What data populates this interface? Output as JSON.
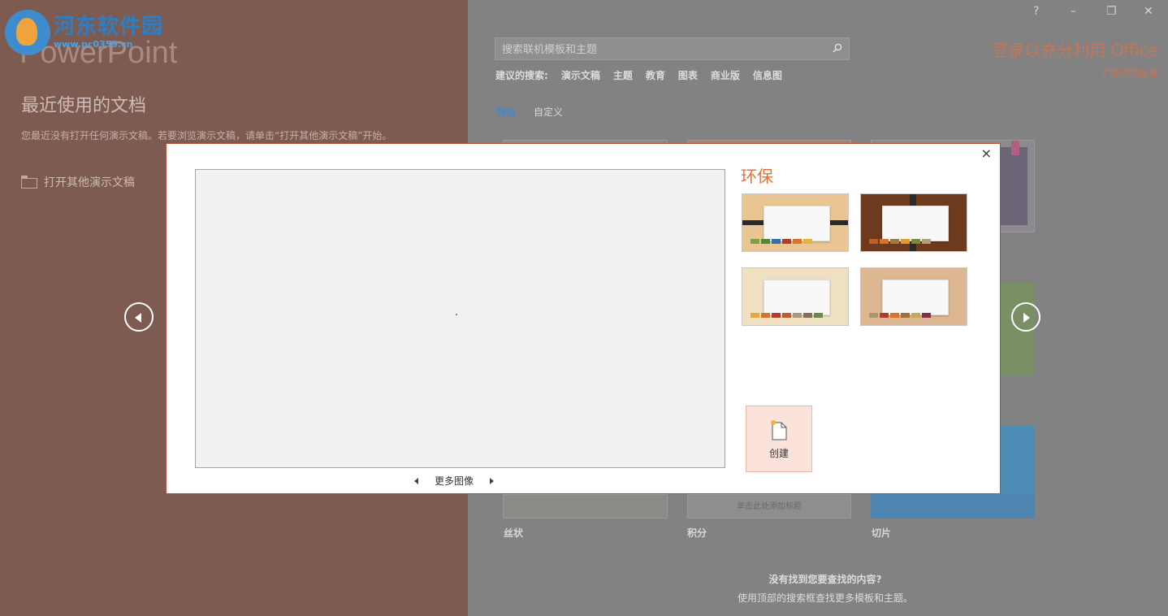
{
  "left": {
    "watermark_text": "河东软件园",
    "watermark_url": "www.pc0359.cn",
    "app_name": "PowerPoint",
    "recent_title": "最近使用的文档",
    "recent_desc": "您最近没有打开任何演示文稿。若要浏览演示文稿，请单击“打开其他演示文稿”开始。",
    "open_other": "打开其他演示文稿"
  },
  "window": {
    "help": "?",
    "minimize": "–",
    "restore": "❐",
    "close": "✕"
  },
  "search": {
    "placeholder": "搜索联机模板和主题"
  },
  "suggest": {
    "label": "建议的搜索:",
    "items": [
      "演示文稿",
      "主题",
      "教育",
      "图表",
      "商业版",
      "信息图"
    ]
  },
  "tabs": {
    "featured": "特色",
    "custom": "自定义"
  },
  "signin": {
    "title": "登录以充分利用 Office",
    "more": "了解详细信息"
  },
  "templates": [
    {
      "label": "丝状"
    },
    {
      "label": "积分",
      "thumb_text": "单击此处添加标题"
    },
    {
      "label": "切片"
    }
  ],
  "bottom": {
    "question": "没有找到您要查找的内容?",
    "hint": "使用顶部的搜索框查找更多模板和主题。"
  },
  "modal": {
    "close": "×",
    "theme_name": "环保",
    "more_images": "更多图像",
    "create": "创建",
    "variants": [
      {
        "bg": "#e9c593",
        "chips": [
          "#7aa344",
          "#4d8a3a",
          "#3a6ea8",
          "#b43c2e",
          "#d9732a",
          "#e7b23a"
        ],
        "bar": true
      },
      {
        "bg": "#6e3a1e",
        "chips": [
          "#c25a2a",
          "#d9732a",
          "#a07a45",
          "#e89a2a",
          "#7a8a3a",
          "#b0a07a"
        ],
        "bar": true
      },
      {
        "bg": "#efe0c2",
        "chips": [
          "#e3a93a",
          "#d9732a",
          "#b43c2e",
          "#c25a2a",
          "#a79a7a",
          "#8a6a5a",
          "#6a8a4a"
        ],
        "bar": false
      },
      {
        "bg": "#dcb791",
        "chips": [
          "#b0956a",
          "#b43c2e",
          "#d9732a",
          "#a0703a",
          "#c8a85a",
          "#8a2a4a"
        ],
        "bar": false
      }
    ]
  },
  "nav": {
    "prev": "prev",
    "next": "next"
  }
}
